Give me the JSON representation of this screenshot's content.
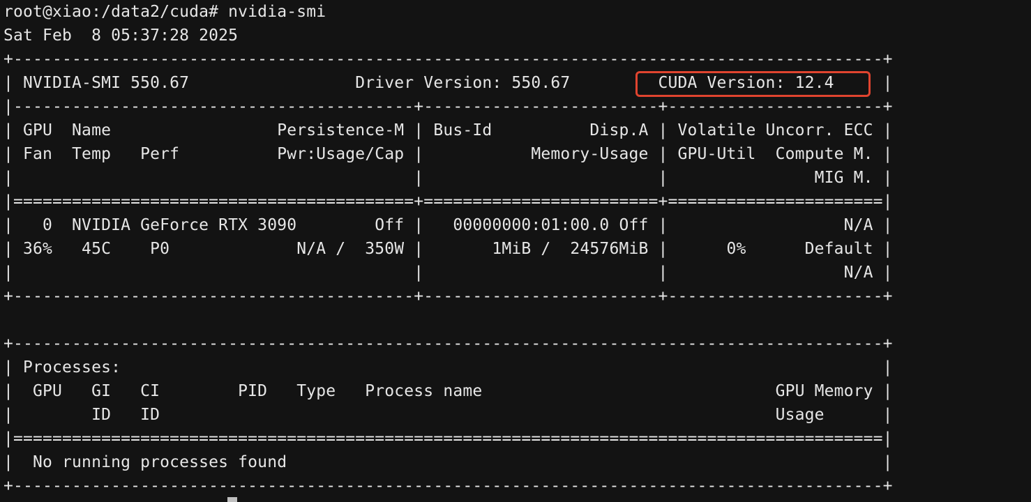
{
  "terminal": {
    "lines": [
      "root@xiao:/data2/cuda# nvidia-smi",
      "Sat Feb  8 05:37:28 2025",
      "+-----------------------------------------------------------------------------------------+",
      "| NVIDIA-SMI 550.67                 Driver Version: 550.67         CUDA Version: 12.4     |",
      "|-----------------------------------------+------------------------+----------------------+",
      "| GPU  Name                 Persistence-M | Bus-Id          Disp.A | Volatile Uncorr. ECC |",
      "| Fan  Temp   Perf          Pwr:Usage/Cap |           Memory-Usage | GPU-Util  Compute M. |",
      "|                                         |                        |               MIG M. |",
      "|=========================================+========================+======================|",
      "|   0  NVIDIA GeForce RTX 3090        Off |   00000000:01:00.0 Off |                  N/A |",
      "| 36%   45C    P0             N/A /  350W |       1MiB /  24576MiB |      0%      Default |",
      "|                                         |                        |                  N/A |",
      "+-----------------------------------------+------------------------+----------------------+",
      "",
      "+-----------------------------------------------------------------------------------------+",
      "| Processes:                                                                              |",
      "|  GPU   GI   CI        PID   Type   Process name                              GPU Memory |",
      "|        ID   ID                                                               Usage      |",
      "|=========================================================================================|",
      "|  No running processes found                                                             |",
      "+-----------------------------------------------------------------------------------------+"
    ]
  },
  "colors": {
    "background": "#131313",
    "text": "#e6e6e6",
    "highlight": "#e0442f"
  }
}
